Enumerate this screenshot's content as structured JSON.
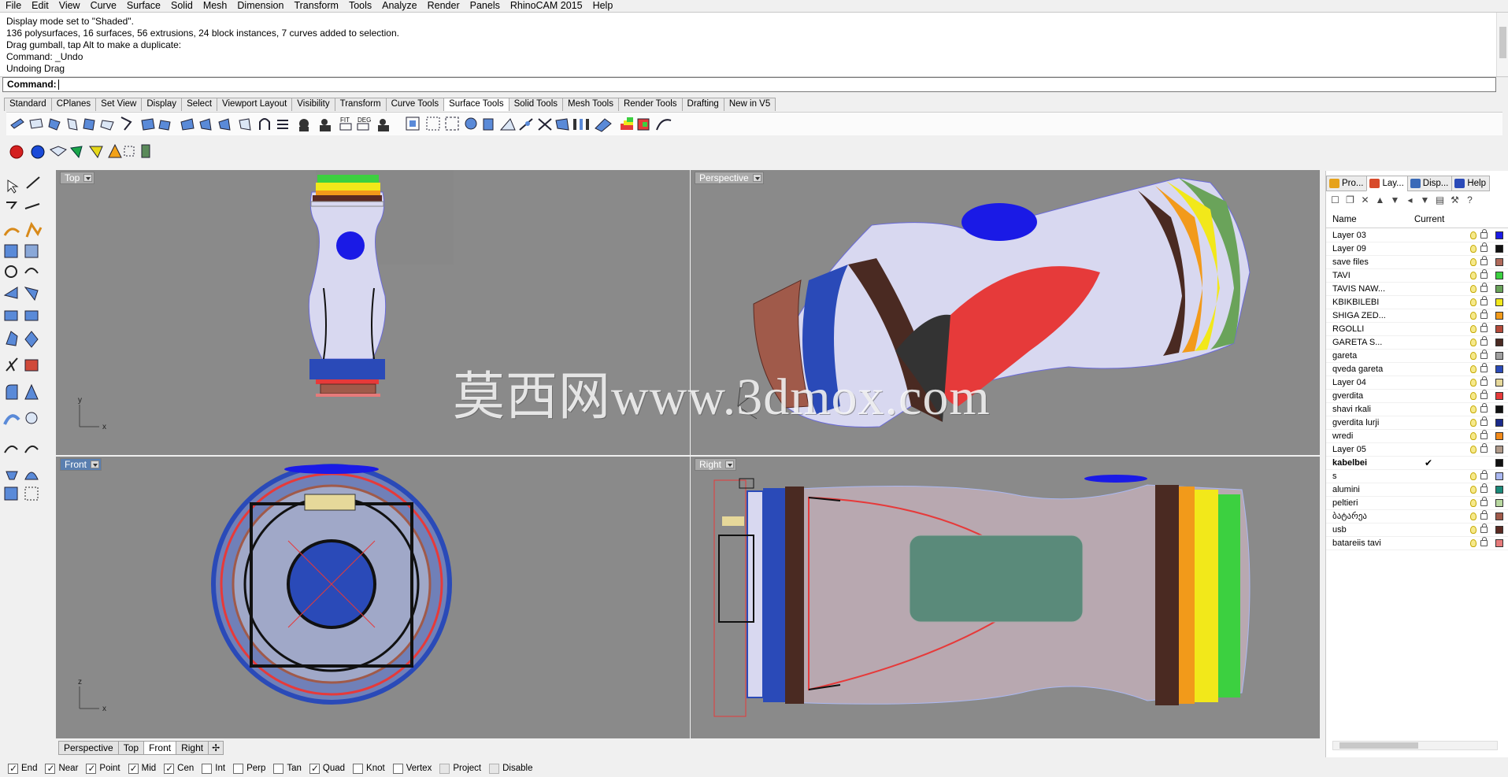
{
  "menu": [
    "File",
    "Edit",
    "View",
    "Curve",
    "Surface",
    "Solid",
    "Mesh",
    "Dimension",
    "Transform",
    "Tools",
    "Analyze",
    "Render",
    "Panels",
    "RhinoCAM 2015",
    "Help"
  ],
  "history": [
    "Display mode set to \"Shaded\".",
    "136 polysurfaces, 16 surfaces, 56 extrusions, 24 block instances, 7 curves added to selection.",
    "Drag gumball, tap Alt to make a duplicate:",
    "Command: _Undo",
    "Undoing Drag"
  ],
  "command": {
    "prompt": "Command:",
    "value": ""
  },
  "toolbar_tabs": [
    "Standard",
    "CPlanes",
    "Set View",
    "Display",
    "Select",
    "Viewport Layout",
    "Visibility",
    "Transform",
    "Curve Tools",
    "Surface Tools",
    "Solid Tools",
    "Mesh Tools",
    "Render Tools",
    "Drafting",
    "New in V5"
  ],
  "active_toolbar_tab": "Surface Tools",
  "viewports": {
    "top": "Top",
    "perspective": "Perspective",
    "front": "Front",
    "right": "Right"
  },
  "axis": {
    "x": "x",
    "y": "y",
    "z": "z"
  },
  "watermark": "莫西网www.3dmox.com",
  "viewport_tabs": [
    "Perspective",
    "Top",
    "Front",
    "Right"
  ],
  "active_viewport_tab": "Front",
  "osnaps": [
    {
      "label": "End",
      "checked": true
    },
    {
      "label": "Near",
      "checked": true
    },
    {
      "label": "Point",
      "checked": true
    },
    {
      "label": "Mid",
      "checked": true
    },
    {
      "label": "Cen",
      "checked": true
    },
    {
      "label": "Int",
      "checked": false
    },
    {
      "label": "Perp",
      "checked": false
    },
    {
      "label": "Tan",
      "checked": false
    },
    {
      "label": "Quad",
      "checked": true
    },
    {
      "label": "Knot",
      "checked": false
    },
    {
      "label": "Vertex",
      "checked": false
    },
    {
      "label": "Project",
      "checked": false,
      "disabled": true
    },
    {
      "label": "Disable",
      "checked": false,
      "disabled": true
    }
  ],
  "panel_tabs": [
    "Pro...",
    "Lay...",
    "Disp...",
    "Help"
  ],
  "active_panel_tab": "Lay...",
  "layer_columns": {
    "name": "Name",
    "current": "Current"
  },
  "layers": [
    {
      "name": "Layer 03",
      "color": "#1a1ae6"
    },
    {
      "name": "Layer 09",
      "color": "#111111"
    },
    {
      "name": "save files",
      "color": "#b06a5a"
    },
    {
      "name": "TAVI",
      "color": "#3cd040"
    },
    {
      "name": "TAVIS NAW...",
      "color": "#6aa35a"
    },
    {
      "name": "KBIKBILEBI",
      "color": "#f2e81a"
    },
    {
      "name": "SHIGA ZED...",
      "color": "#f29a1a"
    },
    {
      "name": "RGOLLI",
      "color": "#b54a3a"
    },
    {
      "name": "GARETA S...",
      "color": "#4a2a22"
    },
    {
      "name": "gareta",
      "color": "#a0a0a0"
    },
    {
      "name": "qveda gareta",
      "color": "#2a4ab8"
    },
    {
      "name": "Layer 04",
      "color": "#e6d89a"
    },
    {
      "name": "gverdita",
      "color": "#e63a3a"
    },
    {
      "name": "shavi rkali",
      "color": "#111111"
    },
    {
      "name": "gverdita lurji",
      "color": "#1a2a8a"
    },
    {
      "name": "wredi",
      "color": "#f28a1a"
    },
    {
      "name": "Layer 05",
      "color": "#b09a8a"
    },
    {
      "name": "kabelbei",
      "color": "#111111",
      "current": true
    },
    {
      "name": "s",
      "color": "#aab8f2"
    },
    {
      "name": "alumini",
      "color": "#1a8a7a"
    },
    {
      "name": "peltieri",
      "color": "#b8d8a0"
    },
    {
      "name": "ბატარეა",
      "color": "#a05a4a"
    },
    {
      "name": "usb",
      "color": "#5a2a22"
    },
    {
      "name": "batareiis tavi",
      "color": "#e67a7a"
    }
  ],
  "current_mark": "✔"
}
